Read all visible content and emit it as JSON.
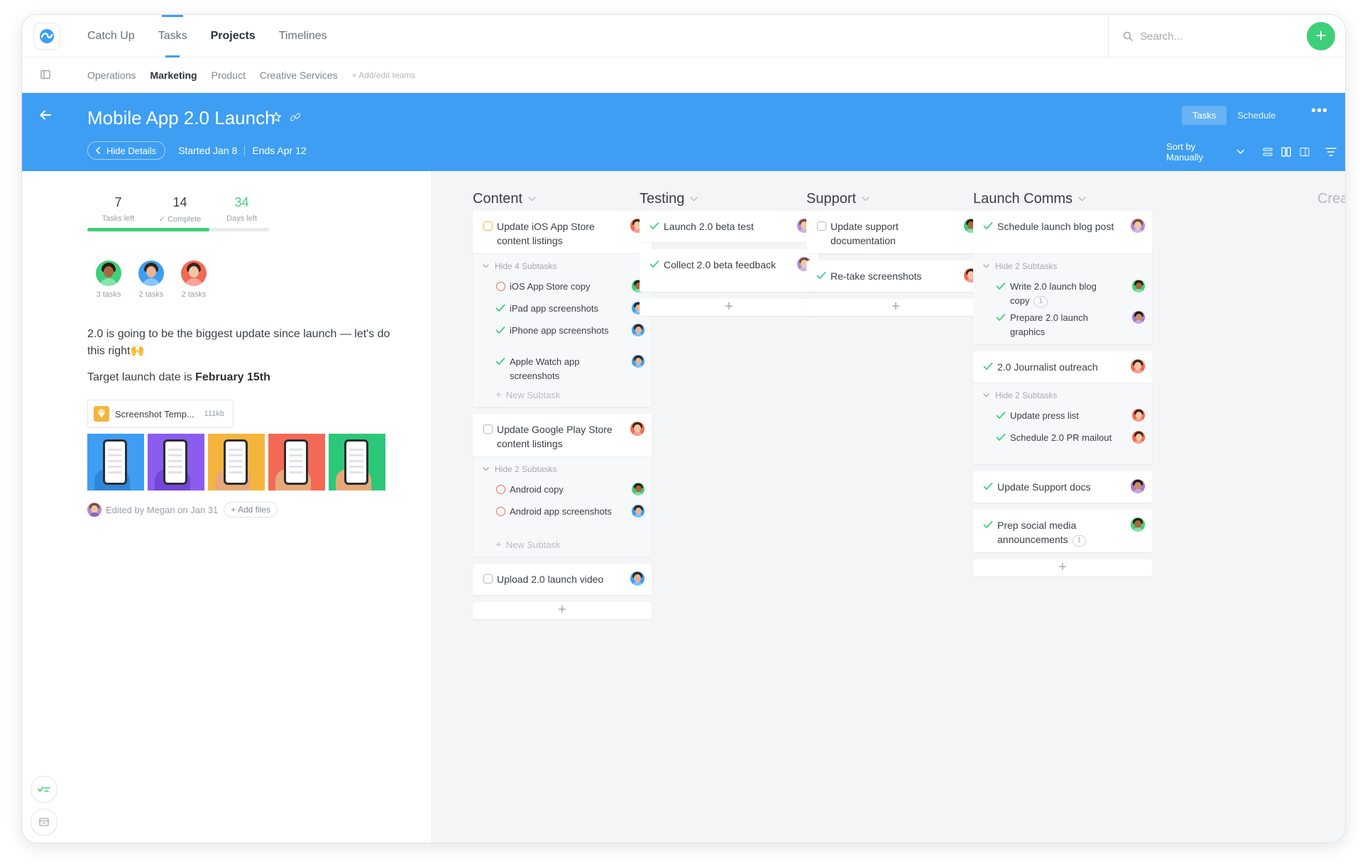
{
  "nav": {
    "tabs": [
      "Catch Up",
      "Tasks",
      "Projects",
      "Timelines"
    ],
    "active_tab": "Projects"
  },
  "search": {
    "placeholder": "Search..."
  },
  "teams": {
    "items": [
      "Operations",
      "Marketing",
      "Product",
      "Creative Services"
    ],
    "active": "Marketing",
    "add_label": "+ Add/edit teams"
  },
  "project": {
    "title": "Mobile App 2.0 Launch",
    "hide_details": "Hide Details",
    "started": "Started Jan 8",
    "ends": "Ends Apr 12",
    "view_tasks": "Tasks",
    "view_schedule": "Schedule",
    "sort": "Sort by Manually"
  },
  "details": {
    "stats": [
      {
        "num": "7",
        "label": "Tasks left"
      },
      {
        "num": "14",
        "label": "✓ Complete"
      },
      {
        "num": "34",
        "label": "Days left"
      }
    ],
    "progress_fraction": 0.67,
    "members": [
      {
        "tasks": "3 tasks",
        "skin": "#a8683f",
        "hair": "#2a1a10",
        "shirt": "#3ecf7a"
      },
      {
        "tasks": "2 tasks",
        "skin": "#e7b48f",
        "hair": "#2c241f",
        "shirt": "#3d9ef3"
      },
      {
        "tasks": "2 tasks",
        "skin": "#f1c7a8",
        "hair": "#3b2618",
        "shirt": "#f26a55"
      }
    ],
    "description": "2.0 is going to be the biggest update since launch — let's do this right🙌",
    "target_prefix": "Target launch date is ",
    "target_date": "February 15th",
    "file": {
      "name": "Screenshot Temp...",
      "size": "111kb"
    },
    "thumbnails": [
      {
        "bg": "#3d9ef3",
        "hand": "#2f86d8"
      },
      {
        "bg": "#8a5cf0",
        "hand": "#7546d8"
      },
      {
        "bg": "#f5b53d",
        "hand": "#e7a878"
      },
      {
        "bg": "#f26a55",
        "hand": "#e7a878"
      },
      {
        "bg": "#2dc77a",
        "hand": "#e7a878"
      }
    ],
    "edited": "Edited by Megan on Jan 31",
    "add_files": "+ Add files"
  },
  "board": {
    "columns": [
      {
        "name": "Content",
        "cards": [
          {
            "title": "Update iOS App Store content listings",
            "status": "open-yellow",
            "avatar": 2,
            "subtasks_toggle": "Hide 4 Subtasks",
            "subtasks": [
              {
                "title": "iOS App Store copy",
                "status": "ring",
                "avatar": 0
              },
              {
                "title": "iPad app screenshots",
                "status": "done",
                "avatar": 1
              },
              {
                "title": "iPhone app screenshots",
                "status": "done",
                "avatar": 1
              },
              {
                "title": "Apple Watch app screenshots",
                "status": "done",
                "avatar": 1
              }
            ],
            "new_subtask": "New Subtask"
          },
          {
            "title": "Update Google Play Store content listings",
            "status": "open",
            "avatar": 2,
            "subtasks_toggle": "Hide 2 Subtasks",
            "subtasks": [
              {
                "title": "Android copy",
                "status": "ring",
                "avatar": 0
              },
              {
                "title": "Android app screenshots",
                "status": "ring",
                "avatar": 1
              }
            ],
            "new_subtask": "New Subtask"
          },
          {
            "title": "Upload 2.0 launch video",
            "status": "open",
            "avatar": 1
          }
        ]
      },
      {
        "name": "Testing",
        "cards": [
          {
            "title": "Launch 2.0 beta test",
            "status": "done",
            "avatar": 3
          },
          {
            "title": "Collect 2.0 beta feedback",
            "status": "done",
            "avatar": 3
          }
        ]
      },
      {
        "name": "Support",
        "cards": [
          {
            "title": "Update support documentation",
            "status": "open",
            "avatar": 0
          },
          {
            "title": "Re-take screenshots",
            "status": "done",
            "avatar": 2
          }
        ]
      },
      {
        "name": "Launch Comms",
        "cards": [
          {
            "title": "Schedule launch blog post",
            "status": "done",
            "avatar": 3,
            "subtasks_toggle": "Hide 2 Subtasks",
            "subtasks": [
              {
                "title": "Write 2.0 launch blog copy",
                "status": "done",
                "avatar": 0,
                "count": "1"
              },
              {
                "title": "Prepare 2.0 launch graphics",
                "status": "done",
                "avatar": 4
              }
            ]
          },
          {
            "title": "2.0 Journalist outreach",
            "status": "done",
            "avatar": 2,
            "subtasks_toggle": "Hide 2 Subtasks",
            "subtasks": [
              {
                "title": "Update press list",
                "status": "done",
                "avatar": 2
              },
              {
                "title": "Schedule 2.0 PR mailout",
                "status": "done",
                "avatar": 2
              }
            ]
          },
          {
            "title": "Update Support docs",
            "status": "done",
            "avatar": 4
          },
          {
            "title": "Prep social media announcements",
            "status": "done",
            "avatar": 0,
            "count": "1"
          }
        ]
      }
    ],
    "create_label": "Create"
  },
  "avatars": [
    {
      "bg": "#3ecf7a",
      "skin": "#a8683f",
      "hair": "#2a1a10"
    },
    {
      "bg": "#3d9ef3",
      "skin": "#e7b48f",
      "hair": "#2c241f"
    },
    {
      "bg": "#f26a55",
      "skin": "#f1c7a8",
      "hair": "#3b2618"
    },
    {
      "bg": "#b28bd6",
      "skin": "#f0c6a6",
      "hair": "#7a4a2a"
    },
    {
      "bg": "#a07ccf",
      "skin": "#c98f66",
      "hair": "#1f1612"
    }
  ],
  "colors": {
    "brand_blue": "#3d9ef3",
    "accent_green": "#3ecf7a",
    "danger_red": "#f26a55",
    "warning_yellow": "#f5b53d"
  }
}
